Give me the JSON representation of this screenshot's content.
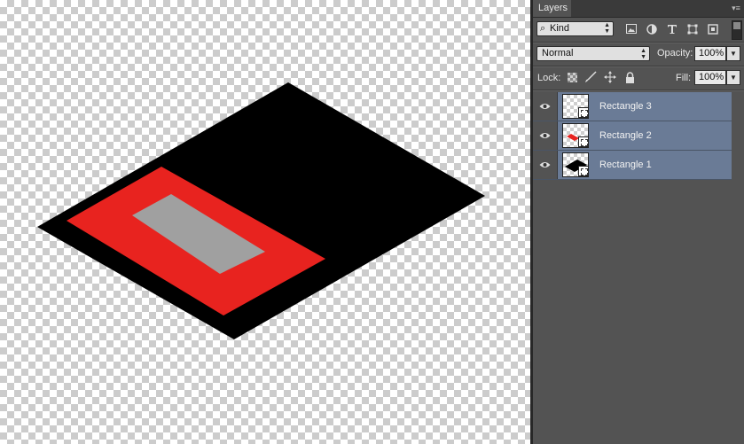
{
  "canvas": {
    "colors": {
      "base": "#000000",
      "frame": "#e8231f",
      "inner": "#a0a0a0"
    }
  },
  "panel": {
    "tab_label": "Layers",
    "menu_icon": "panel-menu-icon",
    "filter": {
      "value": "Kind",
      "icons": [
        "image-filter-icon",
        "adjustment-filter-icon",
        "type-filter-icon",
        "shape-filter-icon",
        "smart-object-filter-icon"
      ]
    },
    "blend_mode": "Normal",
    "opacity_label": "Opacity:",
    "opacity_value": "100%",
    "lock_label": "Lock:",
    "lock_icons": [
      "lock-transparent-icon",
      "lock-paint-icon",
      "lock-move-icon",
      "lock-all-icon"
    ],
    "fill_label": "Fill:",
    "fill_value": "100%",
    "layers": [
      {
        "name": "Rectangle 3",
        "thumb": "empty"
      },
      {
        "name": "Rectangle 2",
        "thumb": "red"
      },
      {
        "name": "Rectangle 1",
        "thumb": "black"
      }
    ],
    "accent": "#6a7b96"
  }
}
